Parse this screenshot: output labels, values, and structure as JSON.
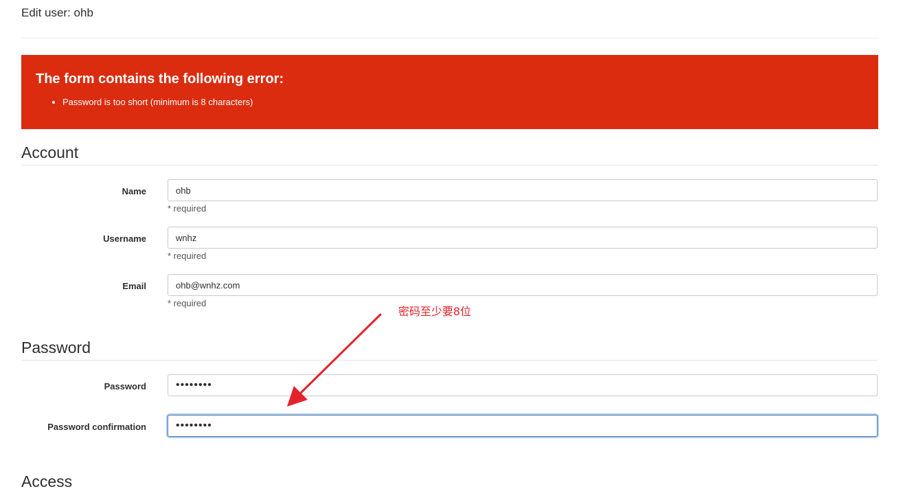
{
  "header": {
    "title": "Edit user: ohb"
  },
  "error": {
    "heading": "The form contains the following error:",
    "items": [
      "Password is too short (minimum is 8 characters)"
    ],
    "color": "#db2c0f"
  },
  "account": {
    "title": "Account",
    "name": {
      "label": "Name",
      "value": "ohb",
      "help": "* required"
    },
    "username": {
      "label": "Username",
      "value": "wnhz",
      "help": "* required"
    },
    "email": {
      "label": "Email",
      "value": "ohb@wnhz.com",
      "help": "* required"
    }
  },
  "password": {
    "title": "Password",
    "password": {
      "label": "Password",
      "value": "••••••••"
    },
    "confirmation": {
      "label": "Password confirmation",
      "value": "••••••••"
    }
  },
  "access": {
    "title": "Access"
  },
  "annotation": {
    "text": "密码至少要8位",
    "color": "#e5222a"
  }
}
